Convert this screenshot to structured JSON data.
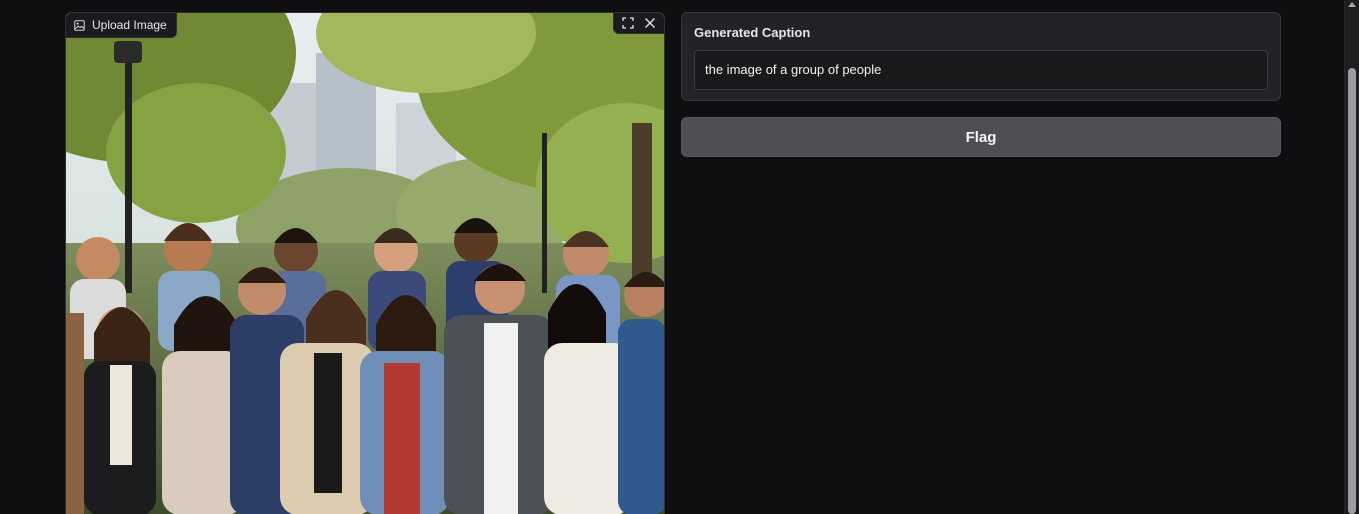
{
  "image_input": {
    "label": "Upload Image",
    "label_icon": "image-icon",
    "fullscreen_icon": "fullscreen-icon",
    "clear_icon": "close-icon"
  },
  "caption": {
    "label": "Generated Caption",
    "value": "the image of a group of people"
  },
  "flag_button": {
    "label": "Flag"
  },
  "colors": {
    "page_background": "#0f0f11",
    "panel_background": "#232327",
    "button_background": "#4f4e55",
    "text": "#f2f2f4"
  }
}
